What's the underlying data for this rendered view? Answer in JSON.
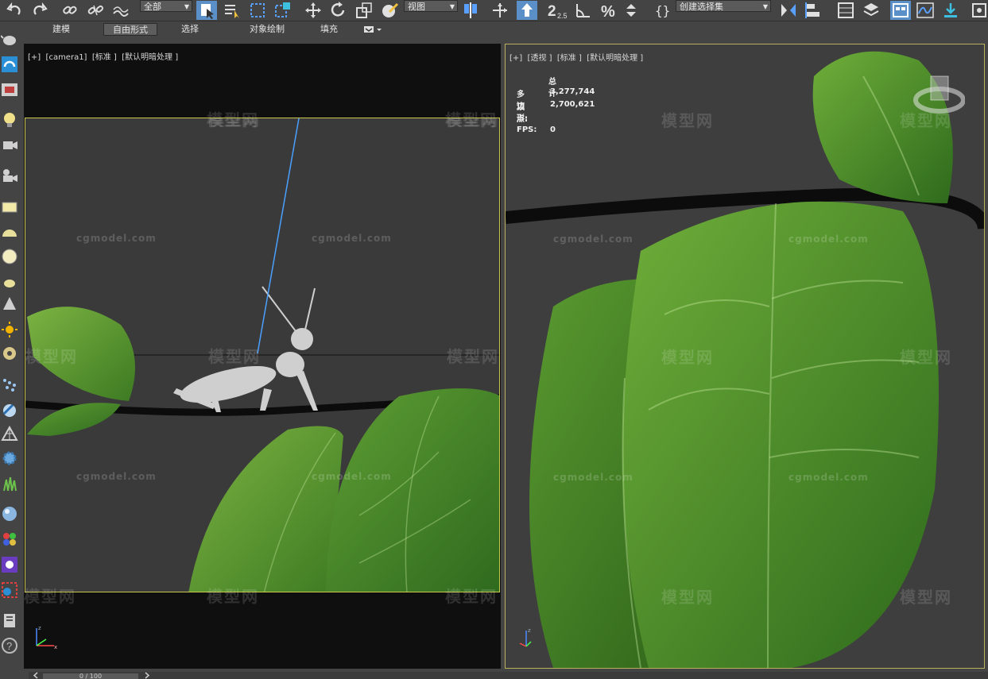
{
  "toolbar": {
    "selection_filter": "全部",
    "coordinate_system": "视图",
    "named_selection_set": "创建选择集",
    "snap_value": "2.5"
  },
  "ribbon": {
    "tabs": [
      "建模",
      "自由形式",
      "选择",
      "对象绘制",
      "填充"
    ],
    "active_tab": "自由形式"
  },
  "viewport_left": {
    "label": "[+]  [camera1]  [标准 ]  [默认明暗处理 ]"
  },
  "viewport_right": {
    "label": "[+]  [透视 ]  [标准 ]  [默认明暗处理 ]",
    "stats": {
      "header": "总计",
      "polygons_label": "多边形:",
      "polygons_value": "3,277,744",
      "vertices_label": "顶点:",
      "vertices_value": "2,700,621",
      "fps_label": "FPS:",
      "fps_value": "0"
    }
  },
  "watermarks": {
    "text": "cgmodel.com",
    "cn_text": "模型网"
  },
  "timeline": {
    "frame_text": "0 / 100"
  },
  "colors": {
    "accent": "#5b8fc8",
    "camera_frame": "#c9c84c",
    "leaf_green": "#4f8a2c"
  }
}
